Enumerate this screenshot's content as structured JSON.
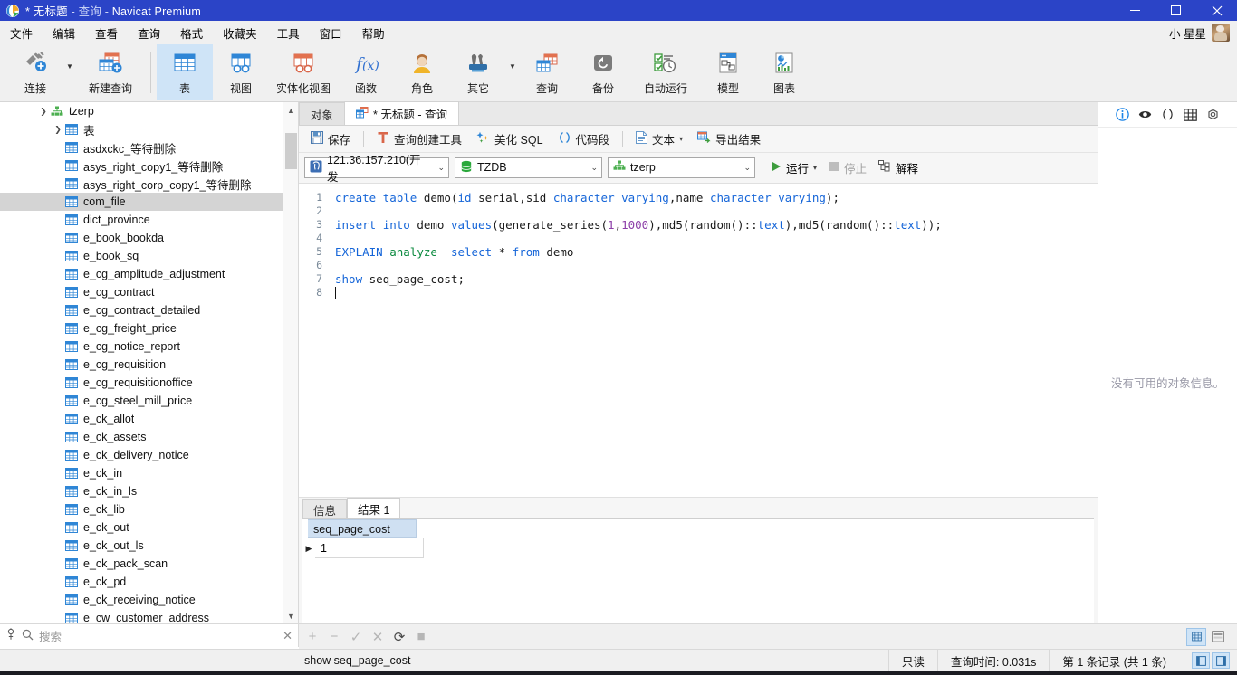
{
  "window": {
    "title_modified": "*",
    "title_doc": "无标题",
    "title_sep1": "-",
    "title_kind": "查询",
    "title_sep2": "-",
    "title_app": "Navicat Premium",
    "minimize": "—",
    "maximize": "▢",
    "close": "✕"
  },
  "menubar": {
    "items": [
      {
        "label": "文件"
      },
      {
        "label": "编辑"
      },
      {
        "label": "查看"
      },
      {
        "label": "查询"
      },
      {
        "label": "格式"
      },
      {
        "label": "收藏夹"
      },
      {
        "label": "工具"
      },
      {
        "label": "窗口"
      },
      {
        "label": "帮助"
      }
    ],
    "user": "小 星星"
  },
  "toolbar": {
    "items": [
      {
        "label": "连接",
        "icon": "connection-icon",
        "has_caret": true,
        "active": false
      },
      {
        "label": "新建查询",
        "icon": "new-query-icon",
        "has_caret": false,
        "active": false
      },
      {
        "label": "表",
        "icon": "table-icon",
        "has_caret": false,
        "active": true
      },
      {
        "label": "视图",
        "icon": "view-icon",
        "has_caret": false,
        "active": false
      },
      {
        "label": "实体化视图",
        "icon": "materialized-view-icon",
        "has_caret": false,
        "active": false
      },
      {
        "label": "函数",
        "icon": "function-icon",
        "has_caret": false,
        "active": false
      },
      {
        "label": "角色",
        "icon": "role-icon",
        "has_caret": false,
        "active": false
      },
      {
        "label": "其它",
        "icon": "others-icon",
        "has_caret": true,
        "active": false
      },
      {
        "label": "查询",
        "icon": "query-icon",
        "has_caret": false,
        "active": false
      },
      {
        "label": "备份",
        "icon": "backup-icon",
        "has_caret": false,
        "active": false
      },
      {
        "label": "自动运行",
        "icon": "automation-icon",
        "has_caret": false,
        "active": false
      },
      {
        "label": "模型",
        "icon": "model-icon",
        "has_caret": false,
        "active": false
      },
      {
        "label": "图表",
        "icon": "chart-icon",
        "has_caret": false,
        "active": false
      }
    ]
  },
  "sidebar": {
    "connection": "tzerp",
    "group": "表",
    "tables": [
      "asdxckc_等待删除",
      "asys_right_copy1_等待删除",
      "asys_right_corp_copy1_等待删除",
      "com_file",
      "dict_province",
      "e_book_bookda",
      "e_book_sq",
      "e_cg_amplitude_adjustment",
      "e_cg_contract",
      "e_cg_contract_detailed",
      "e_cg_freight_price",
      "e_cg_notice_report",
      "e_cg_requisition",
      "e_cg_requisitionoffice",
      "e_cg_steel_mill_price",
      "e_ck_allot",
      "e_ck_assets",
      "e_ck_delivery_notice",
      "e_ck_in",
      "e_ck_in_ls",
      "e_ck_lib",
      "e_ck_out",
      "e_ck_out_ls",
      "e_ck_pack_scan",
      "e_ck_pd",
      "e_ck_receiving_notice",
      "e_cw_customer_address"
    ],
    "selected_table": "com_file",
    "search_placeholder": "搜索",
    "search_clear": "✕"
  },
  "main": {
    "tabs": [
      {
        "label": "对象",
        "active": false,
        "icon": ""
      },
      {
        "label": "* 无标题 - 查询",
        "active": true,
        "icon": "query-tab-icon"
      }
    ],
    "query_toolbar": [
      {
        "label": "保存",
        "icon": "save-icon"
      },
      {
        "label": "查询创建工具",
        "icon": "query-builder-icon"
      },
      {
        "label": "美化 SQL",
        "icon": "beautify-icon"
      },
      {
        "label": "代码段",
        "icon": "snippet-icon"
      },
      {
        "label": "文本",
        "icon": "text-icon",
        "caret": "▾"
      },
      {
        "label": "导出结果",
        "icon": "export-icon"
      }
    ],
    "selects": {
      "server": "121.36.157.210(开发",
      "server_icon": "postgresql-icon",
      "database": "TZDB",
      "database_icon": "database-icon",
      "schema": "tzerp",
      "schema_icon": "schema-icon",
      "caret": "⌄"
    },
    "run_buttons": [
      {
        "label": "运行",
        "icon": "play-icon",
        "disabled": false,
        "caret": "▾"
      },
      {
        "label": "停止",
        "icon": "stop-icon",
        "disabled": true
      },
      {
        "label": "解释",
        "icon": "explain-icon",
        "disabled": false
      }
    ],
    "editor": {
      "line_numbers": [
        "1",
        "2",
        "3",
        "4",
        "5",
        "6",
        "7",
        "8"
      ],
      "lines": [
        [
          {
            "t": "create",
            "c": "k"
          },
          {
            "t": " ",
            "c": ""
          },
          {
            "t": "table",
            "c": "k"
          },
          {
            "t": " demo(",
            "c": ""
          },
          {
            "t": "id",
            "c": "k"
          },
          {
            "t": " serial,sid ",
            "c": ""
          },
          {
            "t": "character",
            "c": "k"
          },
          {
            "t": " ",
            "c": ""
          },
          {
            "t": "varying",
            "c": "k"
          },
          {
            "t": ",name ",
            "c": ""
          },
          {
            "t": "character",
            "c": "k"
          },
          {
            "t": " ",
            "c": ""
          },
          {
            "t": "varying",
            "c": "k"
          },
          {
            "t": ");",
            "c": ""
          }
        ],
        [],
        [
          {
            "t": "insert",
            "c": "k"
          },
          {
            "t": " ",
            "c": ""
          },
          {
            "t": "into",
            "c": "k"
          },
          {
            "t": " demo ",
            "c": ""
          },
          {
            "t": "values",
            "c": "k"
          },
          {
            "t": "(generate_series(",
            "c": ""
          },
          {
            "t": "1",
            "c": "num"
          },
          {
            "t": ",",
            "c": ""
          },
          {
            "t": "1000",
            "c": "num"
          },
          {
            "t": "),md5(random()::",
            "c": ""
          },
          {
            "t": "text",
            "c": "k"
          },
          {
            "t": "),md5(random()::",
            "c": ""
          },
          {
            "t": "text",
            "c": "k"
          },
          {
            "t": "));",
            "c": ""
          }
        ],
        [],
        [
          {
            "t": "EXPLAIN",
            "c": "k"
          },
          {
            "t": " ",
            "c": ""
          },
          {
            "t": "analyze",
            "c": "k2"
          },
          {
            "t": "  ",
            "c": ""
          },
          {
            "t": "select",
            "c": "k"
          },
          {
            "t": " * ",
            "c": ""
          },
          {
            "t": "from",
            "c": "k"
          },
          {
            "t": " demo",
            "c": ""
          }
        ],
        [],
        [
          {
            "t": "show",
            "c": "k"
          },
          {
            "t": " seq_page_cost;",
            "c": ""
          }
        ],
        []
      ]
    },
    "result_tabs": [
      {
        "label": "信息",
        "active": false
      },
      {
        "label": "结果 1",
        "active": true
      }
    ],
    "result_grid": {
      "columns": [
        "seq_page_cost"
      ],
      "rows": [
        [
          "1"
        ]
      ],
      "row_indicator": "▶"
    },
    "right_panel": {
      "icons": [
        "info-icon",
        "eye-icon",
        "parentheses-icon",
        "grid-icon",
        "gear-icon"
      ],
      "empty_text": "没有可用的对象信息。"
    }
  },
  "grid_toolbar": {
    "buttons": [
      "+",
      "−",
      "✓",
      "✕",
      "⟳",
      "■"
    ],
    "view_buttons": [
      "grid-view-icon",
      "form-view-icon"
    ]
  },
  "statusbar": {
    "query_text": "show seq_page_cost",
    "readonly": "只读",
    "query_time": "查询时间: 0.031s",
    "record_info": "第 1 条记录 (共 1 条)"
  },
  "colors": {
    "title_bg": "#2b44c7",
    "accent_blue": "#1565d8",
    "keyword_green": "#0b8a3f",
    "number_purple": "#8d3fa8",
    "selection": "#cfe4f7"
  }
}
